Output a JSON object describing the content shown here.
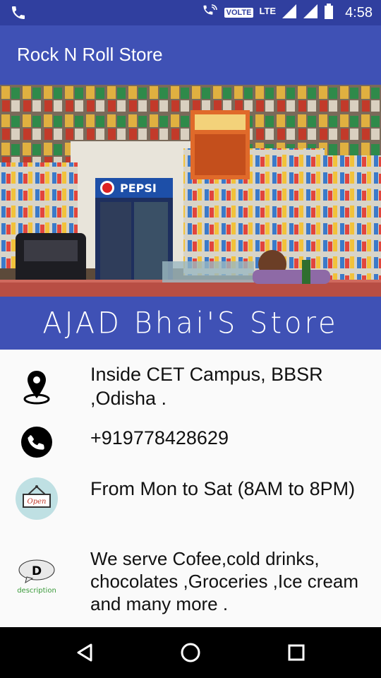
{
  "status_bar": {
    "volte": "VOLTE",
    "lte": "LTE",
    "time": "4:58"
  },
  "app_bar": {
    "title": "Rock N Roll Store"
  },
  "banner": {
    "image_description_icon": "store-interior-photo"
  },
  "store": {
    "name": "AJAD Bhai'S Store"
  },
  "info": {
    "address": "Inside CET Campus, BBSR ,Odisha .",
    "phone": "+919778428629",
    "hours": "From Mon to Sat (8AM to 8PM)",
    "description": "We serve Cofee,cold drinks, chocolates ,Groceries ,Ice cream and many more .",
    "open_sign_text": "Open",
    "description_icon_letter": "D",
    "description_icon_caption": "description"
  },
  "colors": {
    "status_bar": "#303f9f",
    "primary": "#3f51b5",
    "background": "#fafafa"
  }
}
